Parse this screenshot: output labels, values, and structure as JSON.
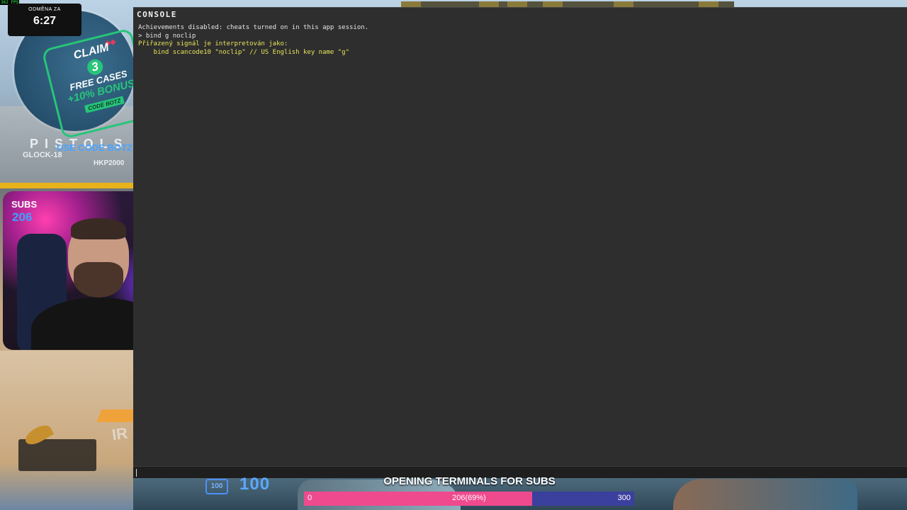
{
  "overlay": {
    "fps_label": "362 FPS",
    "timer_label": "ODMĚNA ZA",
    "timer_value": "6:27",
    "promo_claim": "CLAIM",
    "promo_number": "3",
    "promo_free_cases": "FREE CASES",
    "promo_bonus": "+10% BONUS",
    "promo_code": "CODE BOTZ",
    "use_code": "USE CODE BOTZ",
    "subs_label": "SUBS",
    "subs_value": "206"
  },
  "scene": {
    "wall_text_1": "PISTOLS",
    "wall_text_2": "GLOCK-18",
    "wall_text_3": "HKP2000"
  },
  "console": {
    "title": "CONSOLE",
    "lines": [
      {
        "text": "Achievements disabled: cheats turned on in this app session.",
        "color": "white"
      },
      {
        "text": "> bind g noclip",
        "color": "white"
      },
      {
        "text": "Přiřazený signál je interpretován jako:",
        "color": "yellow"
      },
      {
        "text": "    bind scancode10 \"noclip\" // US English key name \"g\"",
        "color": "yellow"
      }
    ],
    "input_value": ""
  },
  "hud": {
    "armor_icon_text": "100",
    "health_value": "100"
  },
  "sub_goal": {
    "title": "OPENING TERMINALS FOR SUBS",
    "min": "0",
    "max": "300",
    "current_label": "206(69%)",
    "progress": 0.69,
    "fill_color": "#ef4a8e",
    "track_color": "#3b3f9e"
  }
}
